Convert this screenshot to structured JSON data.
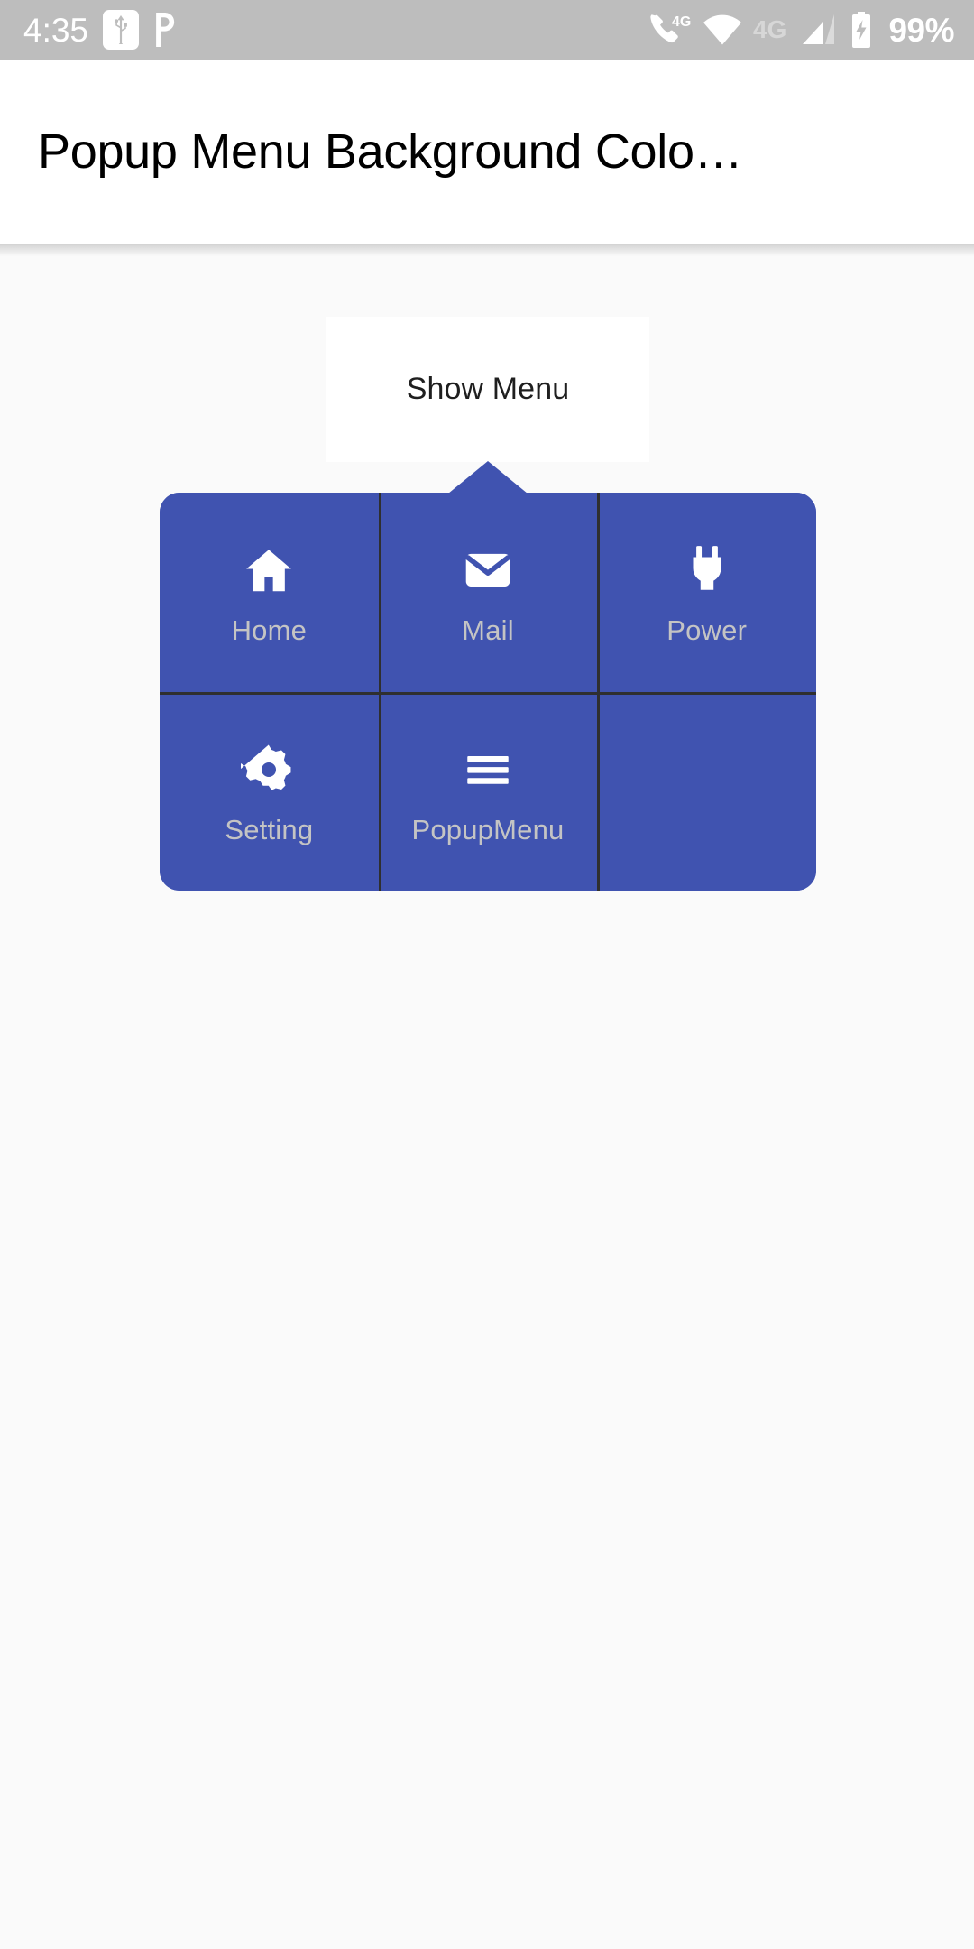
{
  "statusbar": {
    "time": "4:35",
    "battery_percent": "99%",
    "network_label": "4G",
    "network_label_secondary": "4G",
    "icons": {
      "usb": "usb-icon",
      "parking": "P",
      "phone_4g": "phone-4g-icon",
      "wifi": "wifi-icon",
      "signal": "signal-bars-icon",
      "battery": "battery-charging-icon"
    },
    "colors": {
      "background": "#bdbdbd",
      "foreground": "#ffffff"
    }
  },
  "appbar": {
    "title": "Popup Menu Background Colo…",
    "background": "#ffffff",
    "text_color": "#000000"
  },
  "anchor_card": {
    "label": "Show Menu",
    "background": "#ffffff",
    "text_color": "#1f1f1f"
  },
  "popup_menu": {
    "background": "#4053b0",
    "divider_color": "#2f2f2f",
    "label_color": "#c4c4c4",
    "icon_color": "#ffffff",
    "items": [
      {
        "label": "Home",
        "icon": "home-icon"
      },
      {
        "label": "Mail",
        "icon": "mail-icon"
      },
      {
        "label": "Power",
        "icon": "power-plug-icon"
      },
      {
        "label": "Setting",
        "icon": "gear-icon"
      },
      {
        "label": "PopupMenu",
        "icon": "hamburger-menu-icon"
      },
      {
        "label": "",
        "icon": ""
      }
    ]
  },
  "body": {
    "background": "#fafafa"
  }
}
